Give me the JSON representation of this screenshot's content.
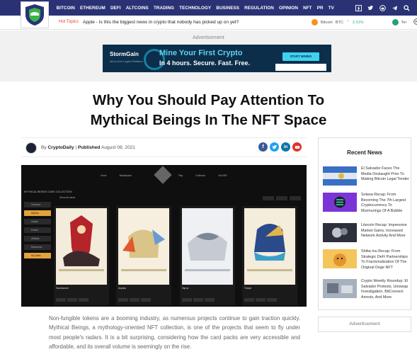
{
  "nav": {
    "links": [
      "BITCOIN",
      "ETHEREUM",
      "DEFI",
      "ALTCOINS",
      "TRADING",
      "TECHNOLOGY",
      "BUSINESS",
      "REGULATION",
      "OPINION",
      "NFT",
      "PR",
      "TV"
    ],
    "icons": [
      "facebook-icon",
      "twitter-icon",
      "reddit-icon",
      "telegram-icon",
      "search-icon"
    ]
  },
  "hotbar": {
    "label": "Hot Topics",
    "headline": "Apple - Is this the biggest news in crypto that nobody has picked up on yet?",
    "ticker": [
      {
        "name": "Bitcoin",
        "symbol": "BTC",
        "change": "3.31%"
      },
      {
        "name": "Ter",
        "symbol": "",
        "change": ""
      }
    ]
  },
  "ad_top": {
    "label": "Advertisement",
    "brand": "StormGain",
    "brand_sub": "All-in-One Crypto Platform",
    "title": "Mine Your First Crypto",
    "line": "In 4 hours. Secure. Fast. Free.",
    "button": "START MINING"
  },
  "article": {
    "title_line1": "Why You Should Pay Attention To",
    "title_line2": "Mythical Beings In The NFT Space",
    "by_prefix": "By",
    "author": "CryptoDaily",
    "published_label": "Published",
    "date": "August 08, 2021",
    "share_icons": [
      "facebook-share",
      "twitter-share",
      "linkedin-share",
      "youtube-share"
    ],
    "body": "Non-fungible tokens are a booming industry, as numerous projects continue to gain traction quickly. Mythical Beings, a mythology-oriented NFT collection, is one of the projects that seem to fly under most people's radars. It is a bit surprising, considering how the card packs are very accessible and affordable, and its overall volume is seemingly on the rise."
  },
  "hero": {
    "nav": [
      "Home",
      "Marketplace",
      "Play",
      "Collection",
      "Get MBT"
    ],
    "subtitle": "MYTHICAL BEINGS CARD COLLECTION",
    "sidebar": [
      "Overview",
      "Mythics",
      "Adepts",
      "Events",
      "Artifacts",
      "Resources",
      "My Cards"
    ],
    "filter": "Show all cards",
    "cards": [
      "Saraharum",
      "Anpalu",
      "Nyrux",
      "Tulpar"
    ]
  },
  "sidebar": {
    "recent_title": "Recent News",
    "items": [
      {
        "title": "El Salvador Faces The Media Onslaught Prior To Making Bitcoin Legal Tender",
        "color": "#5b8fd1"
      },
      {
        "title": "Solana Recap: From Becoming The 7th Largest Cryptocurrency To Murmurings Of A Bubble",
        "color": "#8a3be0"
      },
      {
        "title": "Litecoin Recap: Impressive Market Gains, Increased Network Activity And More",
        "color": "#3a3f55"
      },
      {
        "title": "Shiba Inu Recap: From Strategic DeFi Partnerships To Fractionalization Of The Original Doge NFT",
        "color": "#f0b843"
      },
      {
        "title": "Crypto Weekly Roundup: El Salvador Protests, Uniswap Investigation, BitConnect Arrests, And More",
        "color": "#9aa5b5"
      }
    ],
    "ad_label": "Advertisement"
  }
}
